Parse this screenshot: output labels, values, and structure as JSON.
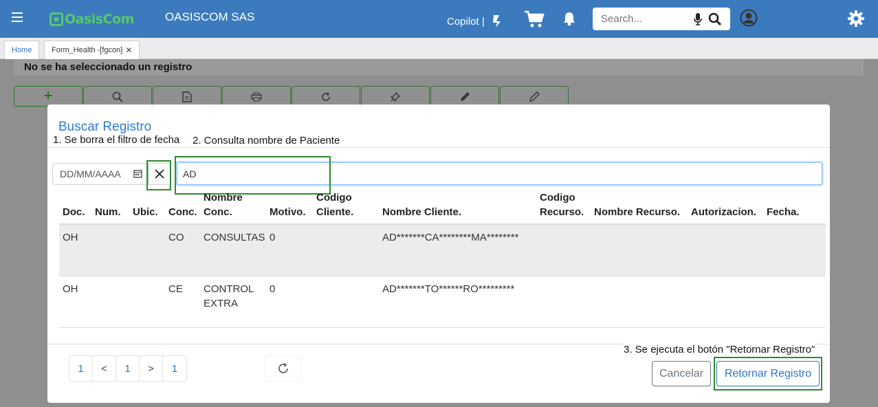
{
  "header": {
    "company": "OASISCOM SAS",
    "logo_text": "OasisCom",
    "copilot_label": "Copilot |",
    "search_placeholder": "Search..."
  },
  "tabs": [
    {
      "label": "Home"
    },
    {
      "label": "Form_Health -[fgcon]"
    }
  ],
  "page": {
    "no_selection": "No se ha seleccionado un registro"
  },
  "modal": {
    "title": "Buscar Registro",
    "annotations": {
      "step1": "1. Se borra el filtro de fecha",
      "step2": "2. Consulta nombre de Paciente",
      "step3": "3. Se ejecuta el botón \"Retornar Registro\""
    },
    "date_placeholder": "DD/MM/AAAA",
    "name_value": "AD",
    "columns": [
      "Doc.",
      "Num.",
      "Ubic.",
      "Conc.",
      "Nombre Conc.",
      "Motivo.",
      "Codigo Cliente.",
      "Nombre Cliente.",
      "Codigo Recurso.",
      "Nombre Recurso.",
      "Autorizacion.",
      "Fecha."
    ],
    "rows": [
      {
        "doc": "OH",
        "num": "",
        "ubic": "",
        "conc": "CO",
        "nombre_conc": "CONSULTAS",
        "motivo": "0",
        "codigo_cliente": "",
        "nombre_cliente": "AD*******CA********MA********",
        "codigo_recurso": "",
        "nombre_recurso": "",
        "autorizacion": "",
        "fecha": ""
      },
      {
        "doc": "OH",
        "num": "",
        "ubic": "",
        "conc": "CE",
        "nombre_conc": "CONTROL EXTRA",
        "motivo": "0",
        "codigo_cliente": "",
        "nombre_cliente": "AD*******TO******RO*********",
        "codigo_recurso": "",
        "nombre_recurso": "",
        "autorizacion": "",
        "fecha": ""
      }
    ],
    "pager": {
      "first": "1",
      "prev": "<",
      "current": "1",
      "next": ">",
      "last": "1"
    },
    "cancel_label": "Cancelar",
    "return_label": "Retornar Registro"
  },
  "colors": {
    "header_bg": "#3b7bbd",
    "accent": "#2c74c6",
    "highlight": "#2c8a2c",
    "logo_green": "#57c86a"
  }
}
